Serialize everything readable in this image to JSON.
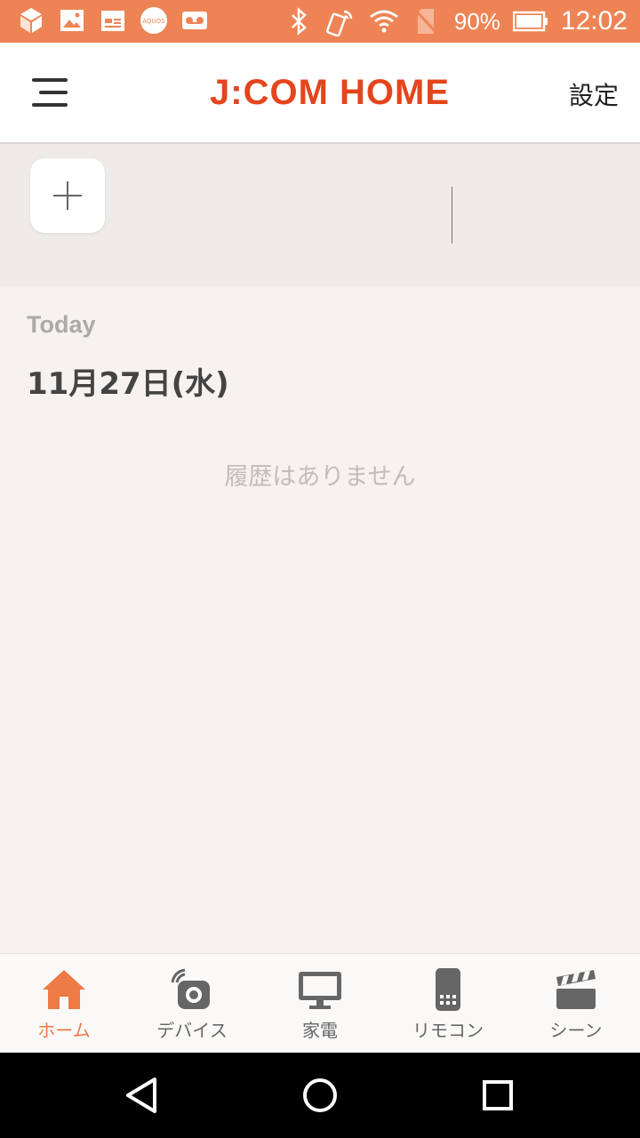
{
  "status_bar": {
    "battery_percent": "90%",
    "time": "12:02",
    "icons": [
      "cube-app-icon",
      "image-icon",
      "calendar-icon",
      "aquos-icon",
      "voicemail-icon",
      "bluetooth-icon",
      "nfc-icon",
      "wifi-icon",
      "no-sim-icon",
      "battery-icon"
    ],
    "aquos_text": "AQUOS"
  },
  "header": {
    "logo": "J:COM HOME",
    "settings_label": "設定"
  },
  "history": {
    "today_label": "Today",
    "date_label": "11月27日(水)",
    "empty_message": "履歴はありません"
  },
  "bottom_nav": {
    "items": [
      {
        "label": "ホーム",
        "icon": "home-icon",
        "active": true
      },
      {
        "label": "デバイス",
        "icon": "device-camera-icon",
        "active": false
      },
      {
        "label": "家電",
        "icon": "monitor-icon",
        "active": false
      },
      {
        "label": "リモコン",
        "icon": "remote-icon",
        "active": false
      },
      {
        "label": "シーン",
        "icon": "clapperboard-icon",
        "active": false
      }
    ]
  },
  "colors": {
    "accent": "#ee8455",
    "logo": "#e4451c",
    "background": "#f6f2ef"
  }
}
